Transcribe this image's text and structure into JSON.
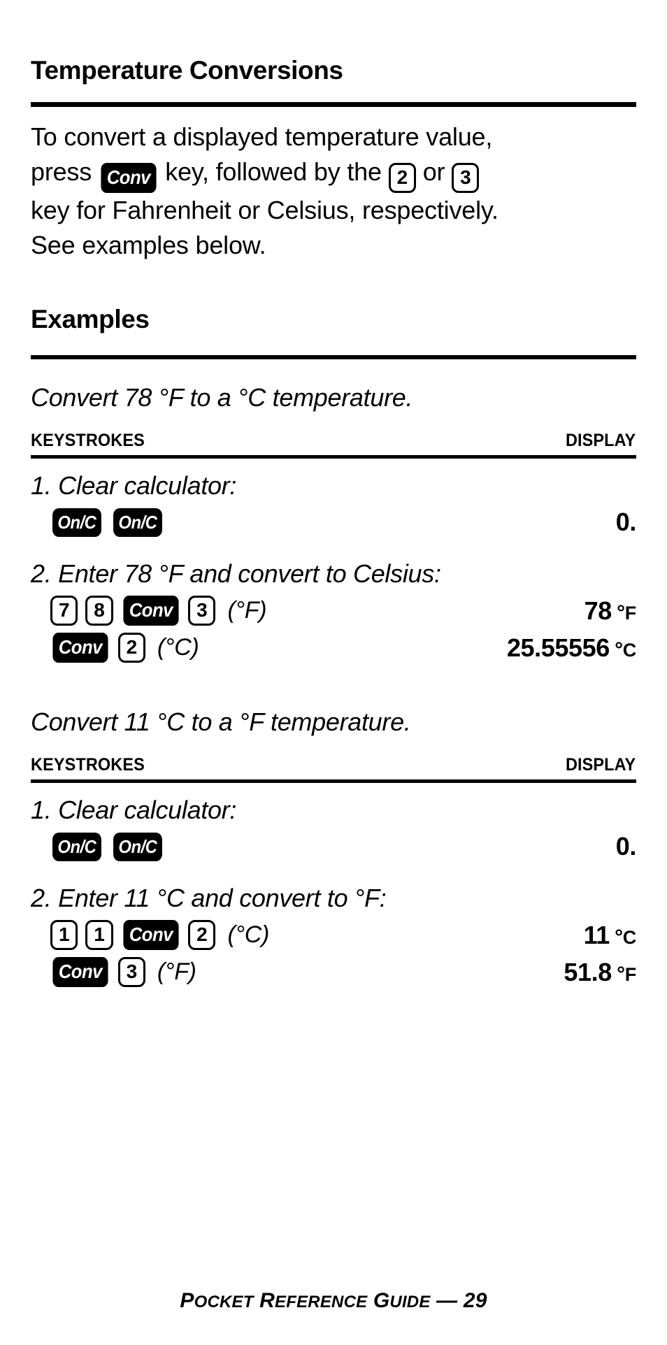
{
  "document": {
    "title": "Temperature Conversions",
    "intro": {
      "line1_a": "To convert a displayed temperature value,",
      "line2_a": "press",
      "key_conv": "Conv",
      "line2_b": "key, followed by the",
      "key_2": "2",
      "line2_c": "or",
      "key_3": "3",
      "line3_a": "key for Fahrenheit or Celsius, respectively.",
      "line4_a": "See examples below."
    },
    "examples_heading": "Examples",
    "columns": {
      "keystrokes": "KEYSTROKES",
      "display": "DISPLAY"
    },
    "examples": [
      {
        "title": "Convert 78 °F to a °C temperature.",
        "steps": [
          {
            "label": "1. Clear calculator:",
            "rows": [
              {
                "keys": [
                  "On/C",
                  "On/C"
                ],
                "key_styles": [
                  "dark",
                  "dark"
                ],
                "annotation": "",
                "display_value": "0.",
                "display_unit": ""
              }
            ]
          },
          {
            "label": "2. Enter 78 °F and convert to Celsius:",
            "rows": [
              {
                "keys": [
                  "7",
                  "8",
                  "Conv",
                  "3"
                ],
                "key_styles": [
                  "light",
                  "light",
                  "dark",
                  "light"
                ],
                "annotation": "(°F)",
                "display_value": "78",
                "display_unit": "°F"
              },
              {
                "keys": [
                  "Conv",
                  "2"
                ],
                "key_styles": [
                  "dark",
                  "light"
                ],
                "annotation": "(°C)",
                "display_value": "25.55556",
                "display_unit": "°C"
              }
            ]
          }
        ]
      },
      {
        "title": "Convert 11 °C to a °F temperature.",
        "steps": [
          {
            "label": "1. Clear calculator:",
            "rows": [
              {
                "keys": [
                  "On/C",
                  "On/C"
                ],
                "key_styles": [
                  "dark",
                  "dark"
                ],
                "annotation": "",
                "display_value": "0.",
                "display_unit": ""
              }
            ]
          },
          {
            "label": "2. Enter 11 °C and convert to °F:",
            "rows": [
              {
                "keys": [
                  "1",
                  "1",
                  "Conv",
                  "2"
                ],
                "key_styles": [
                  "light",
                  "light",
                  "dark",
                  "light"
                ],
                "annotation": "(°C)",
                "display_value": "11",
                "display_unit": "°C"
              },
              {
                "keys": [
                  "Conv",
                  "3"
                ],
                "key_styles": [
                  "dark",
                  "light"
                ],
                "annotation": "(°F)",
                "display_value": "51.8",
                "display_unit": "°F"
              }
            ]
          }
        ]
      }
    ],
    "footer": {
      "text_p": "P",
      "text_ocket": "OCKET",
      "text_r": "R",
      "text_eference": "EFERENCE",
      "text_g": "G",
      "text_uide": "UIDE",
      "separator": "—",
      "page_number": "29"
    }
  }
}
